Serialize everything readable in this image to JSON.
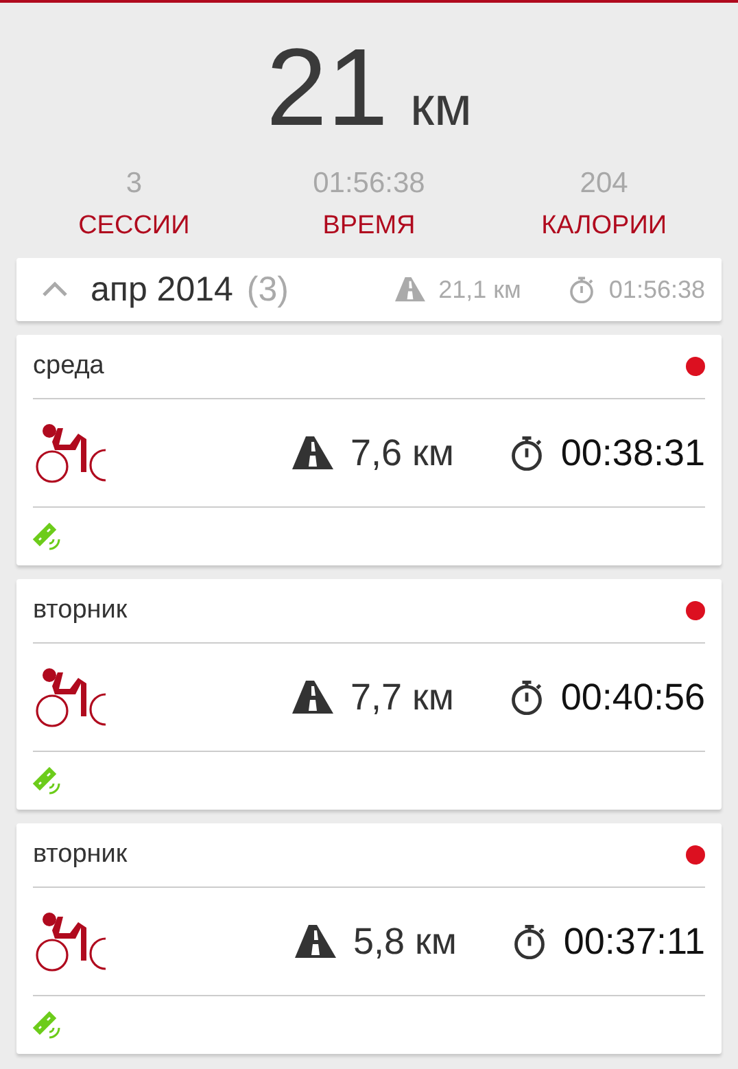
{
  "total": {
    "value": "21",
    "unit": "км"
  },
  "stats": [
    {
      "value": "3",
      "label": "СЕССИИ"
    },
    {
      "value": "01:56:38",
      "label": "ВРЕМЯ"
    },
    {
      "value": "204",
      "label": "КАЛОРИИ"
    }
  ],
  "month": {
    "title": "апр 2014",
    "count": "(3)",
    "expanded": true,
    "distance": "21,1",
    "unit": "км",
    "duration": "01:56:38"
  },
  "sessions": [
    {
      "day": "среда",
      "color": "#dc1020",
      "distance": "7,6",
      "unit": "км",
      "duration": "00:38:31"
    },
    {
      "day": "вторник",
      "color": "#dc1020",
      "distance": "7,7",
      "unit": "км",
      "duration": "00:40:56"
    },
    {
      "day": "вторник",
      "color": "#dc1020",
      "distance": "5,8",
      "unit": "км",
      "duration": "00:37:11"
    }
  ]
}
